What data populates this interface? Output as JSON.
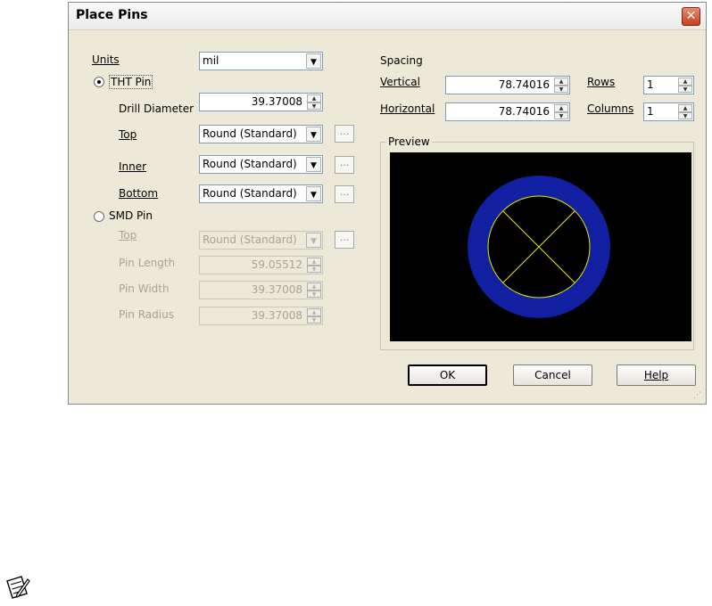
{
  "dialog": {
    "title": "Place Pins",
    "close_glyph": "✕",
    "grip_glyph": "⋰"
  },
  "units": {
    "label": "Units",
    "value": "mil"
  },
  "tht": {
    "label": "THT Pin",
    "selected": true,
    "drill_label": "Drill Diameter",
    "drill_value": "39.37008",
    "top_label": "Top",
    "top_value": "Round (Standard)",
    "inner_label": "Inner",
    "inner_value": "Round (Standard)",
    "bottom_label": "Bottom",
    "bottom_value": "Round (Standard)"
  },
  "smd": {
    "label": "SMD Pin",
    "selected": false,
    "top_label": "Top",
    "top_value": "Round (Standard)",
    "length_label": "Pin Length",
    "length_value": "59.05512",
    "width_label": "Pin Width",
    "width_value": "39.37008",
    "radius_label": "Pin Radius",
    "radius_value": "39.37008"
  },
  "ellipsis_label": "...",
  "spin_up": "▲",
  "spin_down": "▼",
  "dropdown_arrow": "▼",
  "spacing": {
    "label": "Spacing",
    "vertical_label": "Vertical",
    "vertical_value": "78.74016",
    "horizontal_label": "Horizontal",
    "horizontal_value": "78.74016",
    "rows_label": "Rows",
    "rows_value": "1",
    "columns_label": "Columns",
    "columns_value": "1"
  },
  "preview": {
    "label": "Preview",
    "background": "#000000",
    "ring_color": "#1020a0",
    "line_color": "#e8e800"
  },
  "buttons": {
    "ok": "OK",
    "cancel": "Cancel",
    "help": "Help"
  },
  "note_icon": "note-pencil-icon"
}
